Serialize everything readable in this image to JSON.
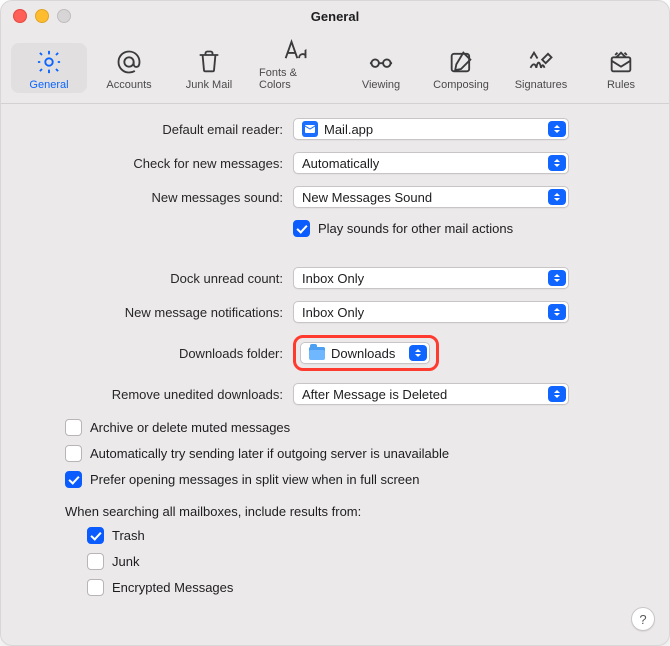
{
  "window": {
    "title": "General"
  },
  "toolbar": {
    "items": [
      {
        "id": "general",
        "label": "General"
      },
      {
        "id": "accounts",
        "label": "Accounts"
      },
      {
        "id": "junkmail",
        "label": "Junk Mail"
      },
      {
        "id": "fontscolors",
        "label": "Fonts & Colors"
      },
      {
        "id": "viewing",
        "label": "Viewing"
      },
      {
        "id": "composing",
        "label": "Composing"
      },
      {
        "id": "signatures",
        "label": "Signatures"
      },
      {
        "id": "rules",
        "label": "Rules"
      }
    ],
    "selected": "general"
  },
  "settings": {
    "default_reader": {
      "label": "Default email reader:",
      "value": "Mail.app"
    },
    "check_messages": {
      "label": "Check for new messages:",
      "value": "Automatically"
    },
    "new_messages_sound": {
      "label": "New messages sound:",
      "value": "New Messages Sound"
    },
    "play_sounds_checkbox": {
      "label": "Play sounds for other mail actions",
      "checked": true
    },
    "dock_unread": {
      "label": "Dock unread count:",
      "value": "Inbox Only"
    },
    "new_msg_notifications": {
      "label": "New message notifications:",
      "value": "Inbox Only"
    },
    "downloads_folder": {
      "label": "Downloads folder:",
      "value": "Downloads"
    },
    "remove_unedited": {
      "label": "Remove unedited downloads:",
      "value": "After Message is Deleted"
    }
  },
  "checkboxes": {
    "archive_muted": {
      "label": "Archive or delete muted messages",
      "checked": false
    },
    "retry_later": {
      "label": "Automatically try sending later if outgoing server is unavailable",
      "checked": false
    },
    "split_view": {
      "label": "Prefer opening messages in split view when in full screen",
      "checked": true
    }
  },
  "search": {
    "heading": "When searching all mailboxes, include results from:",
    "trash": {
      "label": "Trash",
      "checked": true
    },
    "junk": {
      "label": "Junk",
      "checked": false
    },
    "encrypted": {
      "label": "Encrypted Messages",
      "checked": false
    }
  },
  "help_button": "?",
  "icons": {
    "general": "gear-icon",
    "accounts": "at-icon",
    "junkmail": "trash-icon",
    "fontscolors": "font-icon",
    "viewing": "glasses-icon",
    "composing": "compose-icon",
    "signatures": "signature-icon",
    "rules": "rules-icon"
  },
  "colors": {
    "accent": "#0a64ff",
    "highlight": "#ff3b30"
  }
}
